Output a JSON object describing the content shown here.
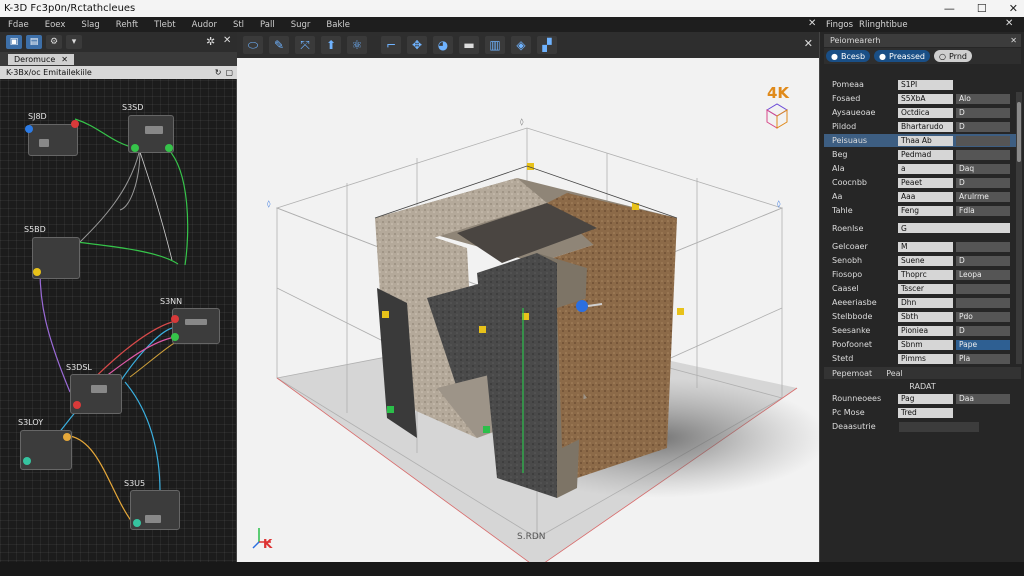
{
  "window": {
    "title": "K-3D Fc3p0n/Rctathcleues",
    "controls": [
      "—",
      "☐",
      "✕"
    ]
  },
  "menubar": {
    "items": [
      "Fdae",
      "Eoex",
      "Slag",
      "Rehft",
      "Tlebt",
      "Audor",
      "Stl",
      "Pall",
      "Sugr",
      "Bakle"
    ],
    "close": "✕",
    "right_items": [
      "Fingos",
      "Rlinghtibue"
    ],
    "right_close": "✕"
  },
  "left_panel": {
    "tab_label": "Deromuce",
    "tab_close": "✕",
    "path": "K-3Bx/oc Emitailekiile",
    "nodes": [
      {
        "label": "SJ8D"
      },
      {
        "label": "S3SD"
      },
      {
        "label": "S5BD"
      },
      {
        "label": "S3NN"
      },
      {
        "label": "S3DSL"
      },
      {
        "label": "S3LOY"
      },
      {
        "label": "S3U5"
      }
    ]
  },
  "viewport": {
    "tools": [
      "arrow",
      "move",
      "scale",
      "rotate",
      "snap",
      "axis",
      "light",
      "camera",
      "grid",
      "view",
      "render"
    ],
    "badge": "4K",
    "coord_label": "S.RDN",
    "axis_label": "K",
    "close": "✕"
  },
  "right_panel": {
    "header": "Peiomearerh",
    "header_close": "✕",
    "tabs": [
      {
        "label": "Bcesb",
        "style": "blue"
      },
      {
        "label": "Preassed",
        "style": "blue"
      },
      {
        "label": "Prnd",
        "style": "light"
      }
    ],
    "rows": [
      {
        "label": "Pomeaa",
        "f1": "S1PI",
        "f2": ""
      },
      {
        "label": "Fosaed",
        "f1": "S5XbA",
        "f2": "Alo"
      },
      {
        "label": "Aysaueoae",
        "f1": "Octdica",
        "f2": "D"
      },
      {
        "label": "Pildod",
        "f1": "Bhartarudo",
        "f2": "D"
      },
      {
        "label": "Peisuaus",
        "f1": "Thaa Ab",
        "f2": "",
        "selected": true
      },
      {
        "label": "Beg",
        "f1": "Pedmad",
        "f2": ""
      },
      {
        "label": "Ala",
        "f1": "a",
        "f2": "Daq"
      },
      {
        "label": "Coocnbb",
        "f1": "Peaet",
        "f2": "D"
      },
      {
        "label": "Aa",
        "f1": "Aaa",
        "f2": "Arulrme"
      },
      {
        "label": "Tahle",
        "f1": "Feng",
        "f2": "Fdla"
      },
      {
        "label": "Roenlse",
        "f1": "G",
        "f2": "G"
      },
      {
        "label": "Gelcoaer",
        "f1": "M",
        "f2": ""
      },
      {
        "label": "Senobh",
        "f1": "Suene",
        "f2": "D"
      },
      {
        "label": "Fiosopo",
        "f1": "Thoprc",
        "f2": "Leopa"
      },
      {
        "label": "Caasel",
        "f1": "Tsscer",
        "f2": ""
      },
      {
        "label": "Aeeeriasbe",
        "f1": "Dhn",
        "f2": ""
      },
      {
        "label": "Stelbbode",
        "f1": "Sbth",
        "f2": "Pdo"
      },
      {
        "label": "Seesanke",
        "f1": "Pioniea",
        "f2": "D"
      },
      {
        "label": "Poofoonet",
        "f1": "Sbnm",
        "f2": "Pape"
      },
      {
        "label": "Stetd",
        "f1": "Pimms",
        "f2": "Pla"
      }
    ],
    "sub_header": [
      "Pepemoat",
      "Peal"
    ],
    "sub_title": "RADAT",
    "sub_rows": [
      {
        "label": "Rounneoees",
        "f1": "Pag",
        "f2": "Daa"
      },
      {
        "label": "Pc Mose",
        "f1": "Tred",
        "f2": ""
      },
      {
        "label": "Deaasutrie",
        "f1": "",
        "f2": ""
      }
    ]
  }
}
